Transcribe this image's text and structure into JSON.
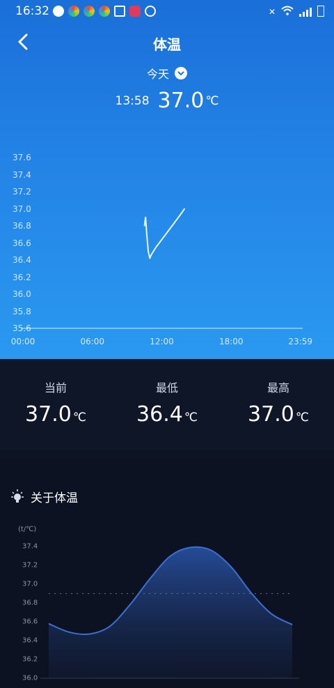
{
  "status": {
    "time": "16:32"
  },
  "header": {
    "title": "体温",
    "back_icon": "chevron-left-icon"
  },
  "date_selector": {
    "label": "今天",
    "icon": "chevron-down-icon"
  },
  "current_reading": {
    "time": "13:58",
    "value": "37.0",
    "unit": "℃"
  },
  "stats": [
    {
      "label": "当前",
      "value": "37.0",
      "unit": "℃"
    },
    {
      "label": "最低",
      "value": "36.4",
      "unit": "℃"
    },
    {
      "label": "最高",
      "value": "37.0",
      "unit": "℃"
    }
  ],
  "about": {
    "title": "关于体温",
    "icon": "lightbulb-icon"
  },
  "colors": {
    "header_top": "#1a6fd8",
    "header_bottom": "#2a99f0",
    "panel": "#0f1628",
    "area_line": "#3d6fd1"
  },
  "chart_data": [
    {
      "type": "line",
      "title": "",
      "xlabel": "",
      "ylabel": "",
      "x_ticks": [
        "00:00",
        "06:00",
        "12:00",
        "18:00",
        "23:59"
      ],
      "y_ticks": [
        "37.6",
        "37.4",
        "37.2",
        "37.0",
        "36.8",
        "36.6",
        "36.4",
        "36.2",
        "36.0",
        "35.8",
        "35.6"
      ],
      "ylim": [
        35.6,
        37.6
      ],
      "xlim_hours": [
        0,
        24
      ],
      "grid": false,
      "series": [
        {
          "x": [
            "10:30",
            "10:36",
            "10:42",
            "10:50",
            "10:58",
            "11:05",
            "11:30",
            "12:00",
            "12:30",
            "13:00",
            "13:30",
            "13:58"
          ],
          "values": [
            36.8,
            36.9,
            36.7,
            36.5,
            36.42,
            36.46,
            36.55,
            36.64,
            36.73,
            36.82,
            36.91,
            37.0
          ]
        }
      ]
    },
    {
      "type": "area",
      "title": "",
      "ylabel": "(t/℃)",
      "y_ticks": [
        "37.4",
        "37.2",
        "37.0",
        "36.8",
        "36.6",
        "36.4",
        "36.2",
        "36.0"
      ],
      "ylim": [
        36.0,
        37.4
      ],
      "reference_line": 36.9,
      "series": [
        {
          "x": [
            0,
            1,
            2,
            3,
            4,
            5,
            6,
            7,
            8,
            9,
            10,
            11,
            12
          ],
          "values": [
            36.58,
            36.49,
            36.47,
            36.55,
            36.78,
            37.06,
            37.3,
            37.39,
            37.36,
            37.18,
            36.9,
            36.68,
            36.57
          ]
        }
      ]
    }
  ]
}
